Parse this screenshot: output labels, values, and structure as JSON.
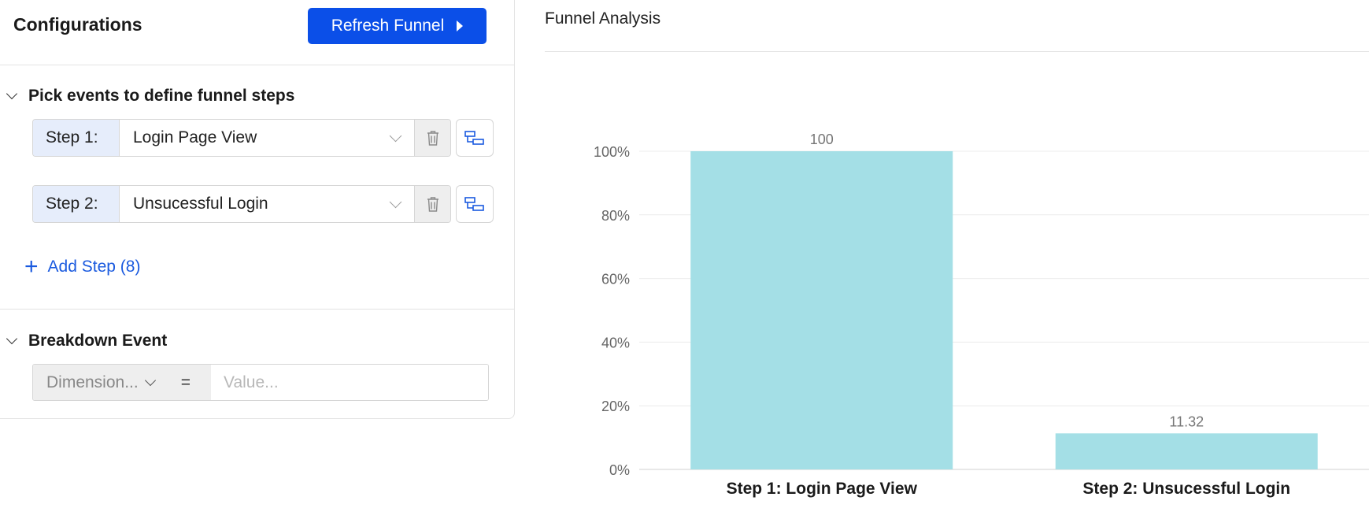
{
  "config": {
    "title": "Configurations",
    "refresh_label": "Refresh Funnel"
  },
  "funnel_steps": {
    "header": "Pick events to define funnel steps",
    "steps": [
      {
        "label": "Step 1:",
        "event": "Login Page View"
      },
      {
        "label": "Step 2:",
        "event": "Unsucessful Login"
      }
    ],
    "add_step_label": "Add Step (8)"
  },
  "breakdown": {
    "header": "Breakdown Event",
    "dimension_label": "Dimension...",
    "operator": "=",
    "value_placeholder": "Value..."
  },
  "analysis": {
    "title": "Funnel Analysis"
  },
  "colors": {
    "accent": "#0b4fe8",
    "bar": "#a4dfe6",
    "link": "#1a5adf"
  },
  "icons": {
    "delete": "trash-icon",
    "step_action": "flow-icon",
    "refresh": "play-icon",
    "collapse": "chevron-down-icon"
  },
  "chart_data": {
    "type": "bar",
    "categories": [
      "Step 1: Login Page View",
      "Step 2: Unsucessful Login"
    ],
    "values": [
      100,
      11.32
    ],
    "data_labels": [
      "100",
      "11.32"
    ],
    "y_ticks": [
      "0%",
      "20%",
      "40%",
      "60%",
      "80%",
      "100%"
    ],
    "ylim": [
      0,
      100
    ],
    "grid": true
  }
}
